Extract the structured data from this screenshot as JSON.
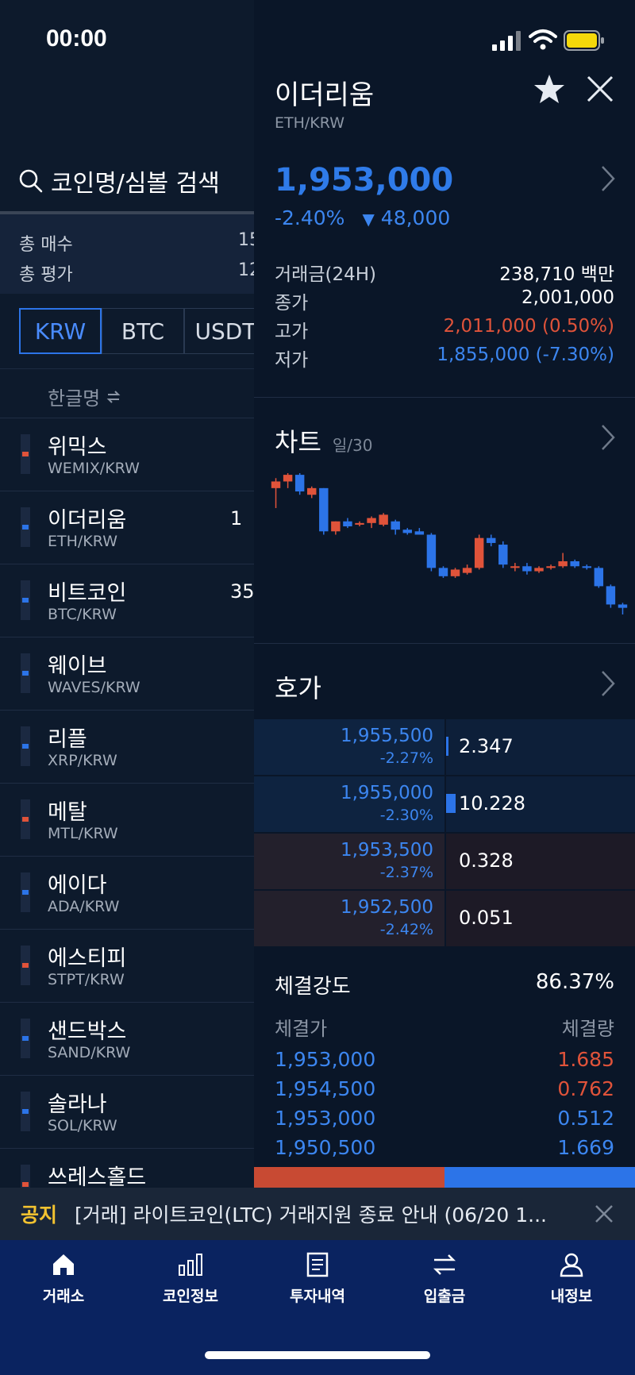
{
  "status_bar": {
    "time": "00:00"
  },
  "left_panel": {
    "search_placeholder": "코인명/심볼 검색",
    "summary": [
      {
        "label": "총 매수",
        "value": "15"
      },
      {
        "label": "총 평가",
        "value": "12"
      }
    ],
    "market_tabs": [
      "KRW",
      "BTC",
      "USDT"
    ],
    "active_market": "KRW",
    "sort_label": "한글명",
    "coins": [
      {
        "name": "위믹스",
        "symbol": "WEMIX/KRW",
        "price": "",
        "trend": "up"
      },
      {
        "name": "이더리움",
        "symbol": "ETH/KRW",
        "price": "1",
        "trend": "down"
      },
      {
        "name": "비트코인",
        "symbol": "BTC/KRW",
        "price": "35",
        "trend": "down"
      },
      {
        "name": "웨이브",
        "symbol": "WAVES/KRW",
        "price": "",
        "trend": "down"
      },
      {
        "name": "리플",
        "symbol": "XRP/KRW",
        "price": "",
        "trend": "down"
      },
      {
        "name": "메탈",
        "symbol": "MTL/KRW",
        "price": "",
        "trend": "up"
      },
      {
        "name": "에이다",
        "symbol": "ADA/KRW",
        "price": "",
        "trend": "down"
      },
      {
        "name": "에스티피",
        "symbol": "STPT/KRW",
        "price": "",
        "trend": "up"
      },
      {
        "name": "샌드박스",
        "symbol": "SAND/KRW",
        "price": "",
        "trend": "down"
      },
      {
        "name": "솔라나",
        "symbol": "SOL/KRW",
        "price": "",
        "trend": "down"
      },
      {
        "name": "쓰레스홀드",
        "symbol": "",
        "price": "",
        "trend": "up"
      }
    ]
  },
  "detail": {
    "name": "이더리움",
    "pair": "ETH/KRW",
    "price": "1,953,000",
    "change_rate": "-2.40%",
    "change_amount": "48,000",
    "stats": [
      {
        "label": "거래금(24H)",
        "value": "238,710 백만",
        "color": "white"
      },
      {
        "label": "종가",
        "value": "2,001,000",
        "color": "white"
      },
      {
        "label": "고가",
        "value": "2,011,000 (0.50%)",
        "color": "red"
      },
      {
        "label": "저가",
        "value": "1,855,000 (-7.30%)",
        "color": "blue"
      }
    ],
    "chart_section": {
      "title": "차트",
      "period": "일/30"
    },
    "orderbook_section": {
      "title": "호가"
    },
    "orderbook": [
      {
        "price": "1,955,500",
        "pct": "-2.27%",
        "qty": "2.347",
        "side": "ask",
        "depth": 0.01
      },
      {
        "price": "1,955,000",
        "pct": "-2.30%",
        "qty": "10.228",
        "side": "ask",
        "depth": 0.05
      },
      {
        "price": "1,953,500",
        "pct": "-2.37%",
        "qty": "0.328",
        "side": "bid",
        "depth": 0
      },
      {
        "price": "1,952,500",
        "pct": "-2.42%",
        "qty": "0.051",
        "side": "bid",
        "depth": 0
      }
    ],
    "strength": {
      "label": "체결강도",
      "value": "86.37%"
    },
    "trades_header": {
      "price": "체결가",
      "qty": "체결량"
    },
    "trades": [
      {
        "price": "1,953,000",
        "qty": "1.685",
        "side": "buy"
      },
      {
        "price": "1,954,500",
        "qty": "0.762",
        "side": "buy"
      },
      {
        "price": "1,953,000",
        "qty": "0.512",
        "side": "sell"
      },
      {
        "price": "1,950,500",
        "qty": "1.669",
        "side": "sell"
      }
    ]
  },
  "notice": {
    "tag": "공지",
    "text": "[거래] 라이트코인(LTC) 거래지원 종료 안내 (06/20 1..."
  },
  "tabbar": [
    {
      "label": "거래소",
      "icon": "home-icon"
    },
    {
      "label": "코인정보",
      "icon": "bar-chart-icon"
    },
    {
      "label": "투자내역",
      "icon": "document-icon"
    },
    {
      "label": "입출금",
      "icon": "transfer-icon"
    },
    {
      "label": "내정보",
      "icon": "person-icon"
    }
  ],
  "colors": {
    "up": "#e0533a",
    "down": "#2c74e8",
    "accent": "#2f7be9",
    "notice_tag": "#f2c230"
  },
  "chart_data": {
    "type": "candlestick",
    "candles": [
      {
        "o": 2300,
        "h": 2330,
        "l": 2240,
        "c": 2320
      },
      {
        "o": 2320,
        "h": 2345,
        "l": 2300,
        "c": 2340
      },
      {
        "o": 2340,
        "h": 2345,
        "l": 2280,
        "c": 2290
      },
      {
        "o": 2280,
        "h": 2305,
        "l": 2270,
        "c": 2300
      },
      {
        "o": 2300,
        "h": 2300,
        "l": 2160,
        "c": 2170
      },
      {
        "o": 2170,
        "h": 2200,
        "l": 2160,
        "c": 2200
      },
      {
        "o": 2200,
        "h": 2210,
        "l": 2180,
        "c": 2185
      },
      {
        "o": 2190,
        "h": 2200,
        "l": 2185,
        "c": 2195
      },
      {
        "o": 2195,
        "h": 2215,
        "l": 2180,
        "c": 2210
      },
      {
        "o": 2190,
        "h": 2225,
        "l": 2185,
        "c": 2220
      },
      {
        "o": 2200,
        "h": 2205,
        "l": 2160,
        "c": 2175
      },
      {
        "o": 2175,
        "h": 2180,
        "l": 2160,
        "c": 2165
      },
      {
        "o": 2170,
        "h": 2180,
        "l": 2160,
        "c": 2160
      },
      {
        "o": 2160,
        "h": 2165,
        "l": 2050,
        "c": 2060
      },
      {
        "o": 2060,
        "h": 2065,
        "l": 2030,
        "c": 2035
      },
      {
        "o": 2035,
        "h": 2060,
        "l": 2030,
        "c": 2055
      },
      {
        "o": 2045,
        "h": 2070,
        "l": 2040,
        "c": 2060
      },
      {
        "o": 2060,
        "h": 2160,
        "l": 2055,
        "c": 2150
      },
      {
        "o": 2150,
        "h": 2160,
        "l": 2125,
        "c": 2135
      },
      {
        "o": 2130,
        "h": 2140,
        "l": 2060,
        "c": 2070
      },
      {
        "o": 2060,
        "h": 2075,
        "l": 2050,
        "c": 2065
      },
      {
        "o": 2065,
        "h": 2075,
        "l": 2040,
        "c": 2050
      },
      {
        "o": 2050,
        "h": 2065,
        "l": 2045,
        "c": 2060
      },
      {
        "o": 2060,
        "h": 2070,
        "l": 2055,
        "c": 2065
      },
      {
        "o": 2065,
        "h": 2105,
        "l": 2060,
        "c": 2080
      },
      {
        "o": 2080,
        "h": 2085,
        "l": 2060,
        "c": 2065
      },
      {
        "o": 2065,
        "h": 2070,
        "l": 2055,
        "c": 2060
      },
      {
        "o": 2060,
        "h": 2065,
        "l": 2000,
        "c": 2005
      },
      {
        "o": 2005,
        "h": 2010,
        "l": 1940,
        "c": 1950
      },
      {
        "o": 1950,
        "h": 1955,
        "l": 1920,
        "c": 1940
      }
    ]
  }
}
